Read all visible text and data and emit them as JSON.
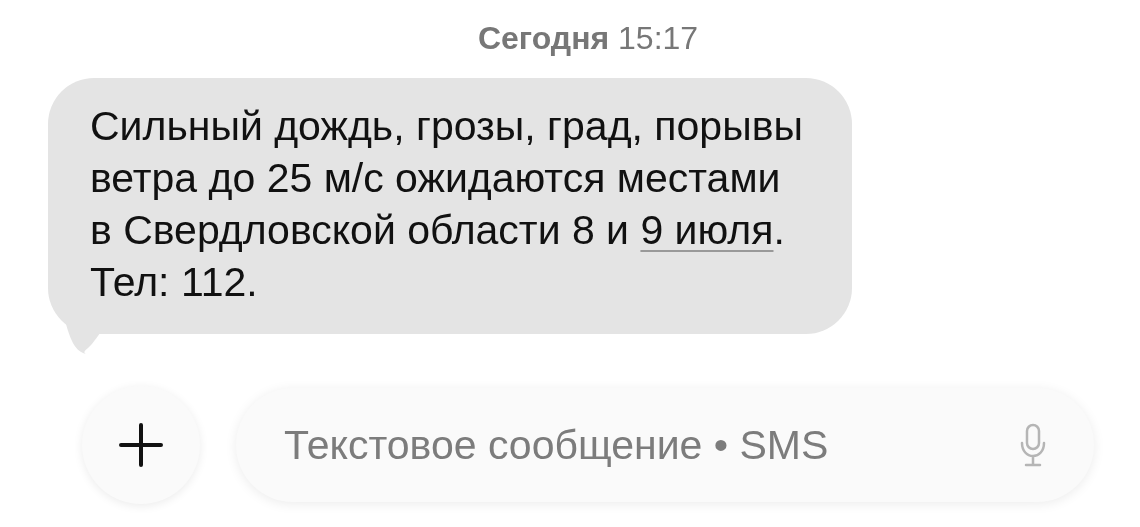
{
  "timestamp": {
    "day": "Сегодня",
    "time": "15:17"
  },
  "message": {
    "text_before": "Сильный дождь, грозы, град, порывы ветра до 25 м/с ожидаются местами в Свердловской области 8 и ",
    "link": "9 июля",
    "text_after": ". Тел: 112."
  },
  "composer": {
    "placeholder": "Текстовое сообщение • SMS"
  }
}
